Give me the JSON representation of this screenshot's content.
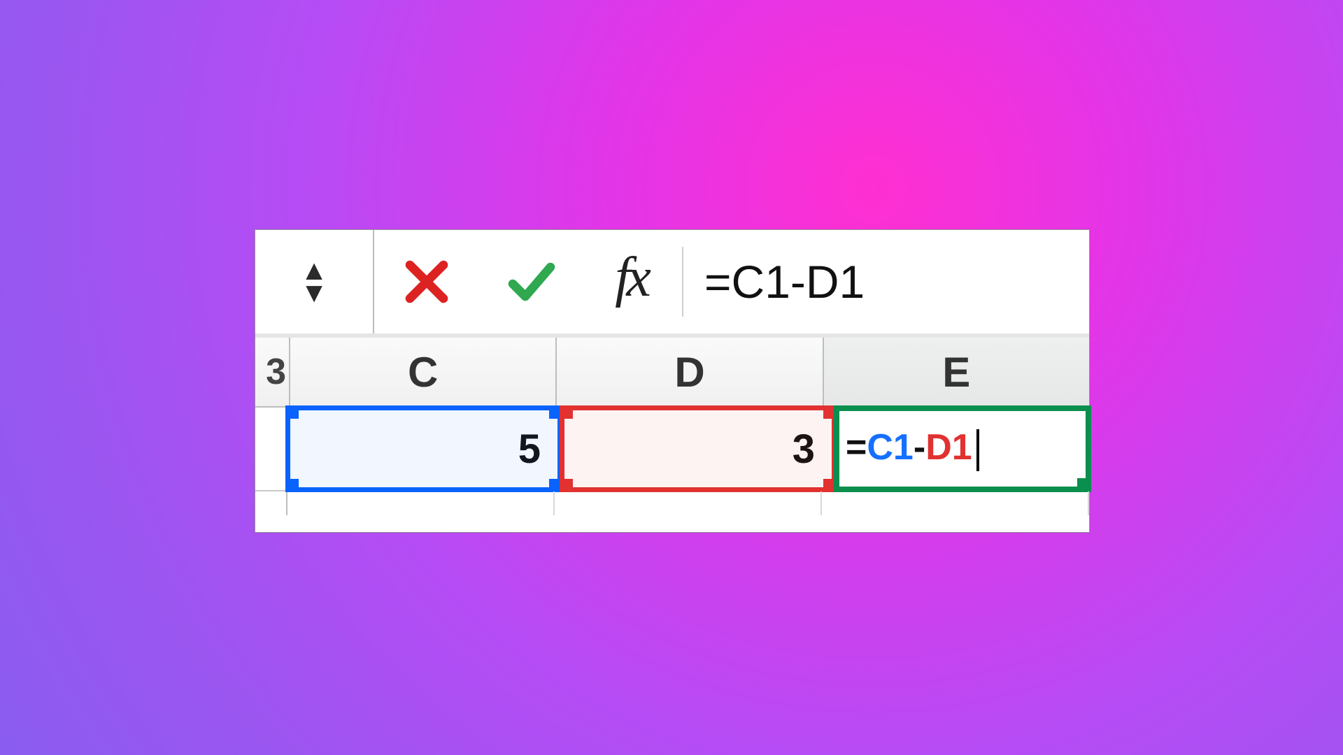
{
  "formula_bar": {
    "value": "=C1-D1"
  },
  "columns": {
    "partial_b": "3",
    "c": "C",
    "d": "D",
    "e": "E"
  },
  "row1": {
    "c_value": "5",
    "d_value": "3",
    "e_formula": {
      "eq": "=",
      "refC": "C1",
      "minus": "-",
      "refD": "D1"
    }
  },
  "colors": {
    "ref_c": "#1670ff",
    "ref_d": "#e13131",
    "active": "#0a8f4e"
  }
}
